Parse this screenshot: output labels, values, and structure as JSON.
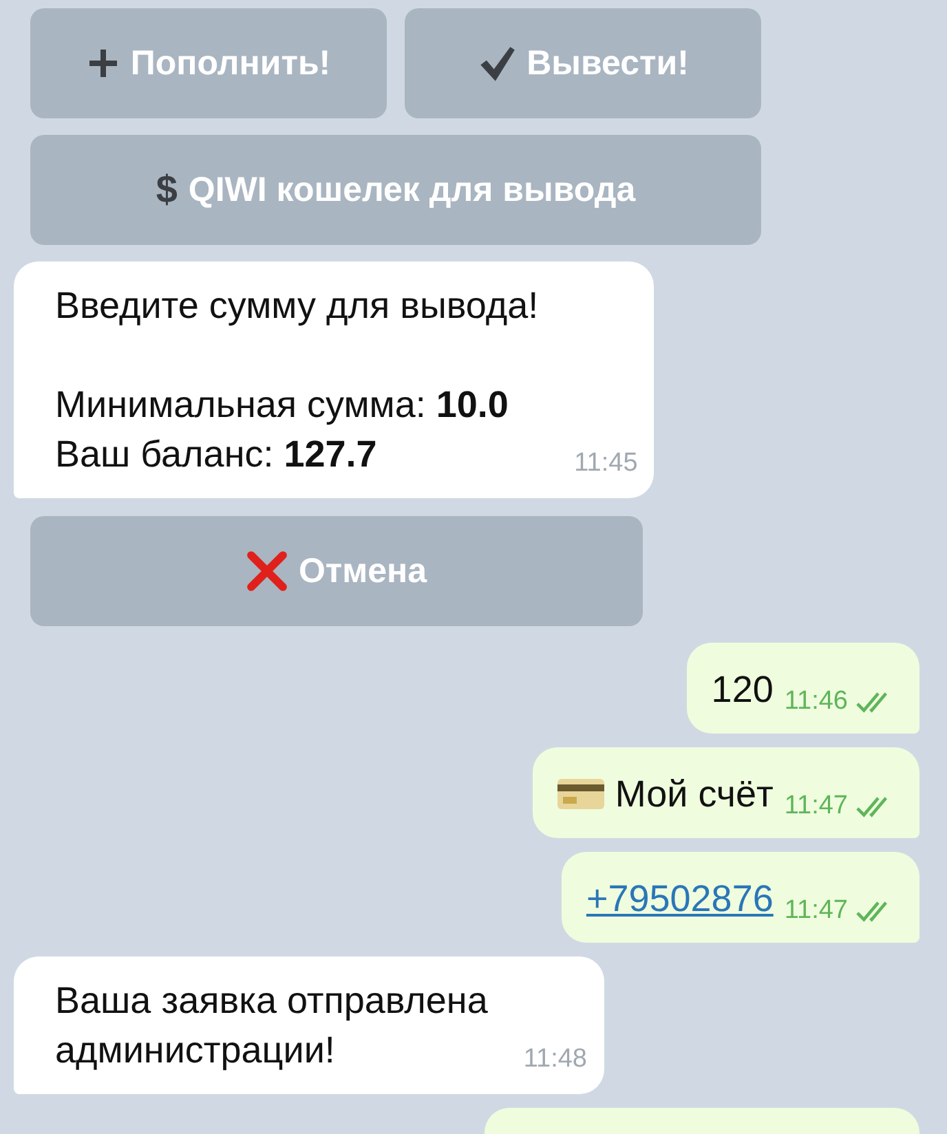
{
  "chat": [
    {
      "kind": "keyboard",
      "rows": [
        [
          {
            "kind": "plus",
            "label": "Пополнить!"
          },
          {
            "kind": "check",
            "label": "Вывести!"
          }
        ],
        [
          {
            "kind": "symbol",
            "symbol": "$",
            "label": "QIWI кошелек для вывода"
          }
        ]
      ]
    },
    {
      "kind": "incoming",
      "blocks": [
        [
          "Введите сумму для вывода!"
        ],
        [
          "Минимальная сумма: **10.0**",
          "Ваш баланс: **127.7**"
        ]
      ],
      "time": "11:45"
    },
    {
      "kind": "keyboard",
      "rows": [
        [
          {
            "kind": "cross",
            "label": "Отмена"
          }
        ]
      ]
    },
    {
      "kind": "outgoing",
      "text": "120",
      "time": "11:46",
      "read": true
    },
    {
      "kind": "outgoing_card",
      "text": "Мой счёт",
      "time": "11:47",
      "read": true
    },
    {
      "kind": "outgoing_link",
      "text": "+79502876",
      "time": "11:47",
      "read": true
    },
    {
      "kind": "incoming",
      "blocks": [
        [
          "Ваша заявка отправлена",
          "администрации!"
        ]
      ],
      "time": "11:48"
    }
  ]
}
